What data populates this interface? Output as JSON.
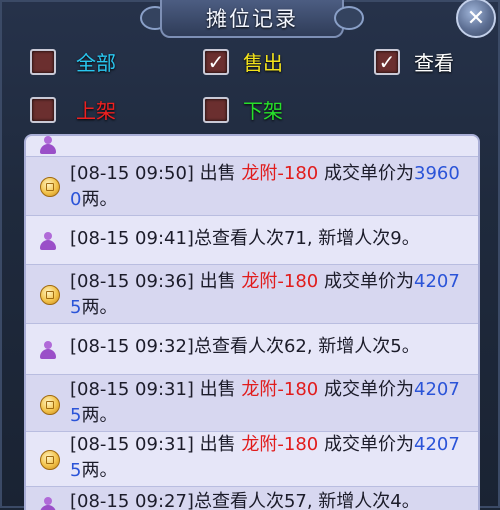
{
  "window": {
    "title": "摊位记录",
    "close_label": "✕"
  },
  "filters": [
    {
      "label": "全部",
      "checked": false,
      "color": "#29c7f0"
    },
    {
      "label": "售出",
      "checked": true,
      "color": "#f2e21b"
    },
    {
      "label": "查看",
      "checked": true,
      "color": "#ffffff"
    },
    {
      "label": "上架",
      "checked": false,
      "color": "#ee2020"
    },
    {
      "label": "下架",
      "checked": false,
      "color": "#27e02a"
    }
  ],
  "colors": {
    "item_name": "#e11c1c",
    "price": "#2b54d8",
    "text": "#1c1c2a"
  },
  "records": [
    {
      "type": "view",
      "text": ""
    },
    {
      "type": "sale",
      "timestamp": "[08-15 09:50]",
      "action": " 出售 ",
      "item": "龙附-180",
      "middle": " 成交单价为",
      "price": "39600",
      "unit": "两。"
    },
    {
      "type": "view",
      "text": "[08-15 09:41]总查看人次71, 新增人次9。"
    },
    {
      "type": "sale",
      "timestamp": "[08-15 09:36]",
      "action": " 出售 ",
      "item": "龙附-180",
      "middle": " 成交单价为",
      "price": "42075",
      "unit": "两。"
    },
    {
      "type": "view",
      "text": "[08-15 09:32]总查看人次62, 新增人次5。"
    },
    {
      "type": "sale",
      "timestamp": "[08-15 09:31]",
      "action": " 出售 ",
      "item": "龙附-180",
      "middle": " 成交单价为",
      "price": "42075",
      "unit": "两。"
    },
    {
      "type": "sale",
      "timestamp": "[08-15 09:31]",
      "action": " 出售 ",
      "item": "龙附-180",
      "middle": " 成交单价为",
      "price": "42075",
      "unit": "两。"
    },
    {
      "type": "view",
      "text": "[08-15 09:27]总查看人次57, 新增人次4。"
    }
  ],
  "icons": {
    "sale": "coin-icon",
    "view": "person-icon"
  }
}
